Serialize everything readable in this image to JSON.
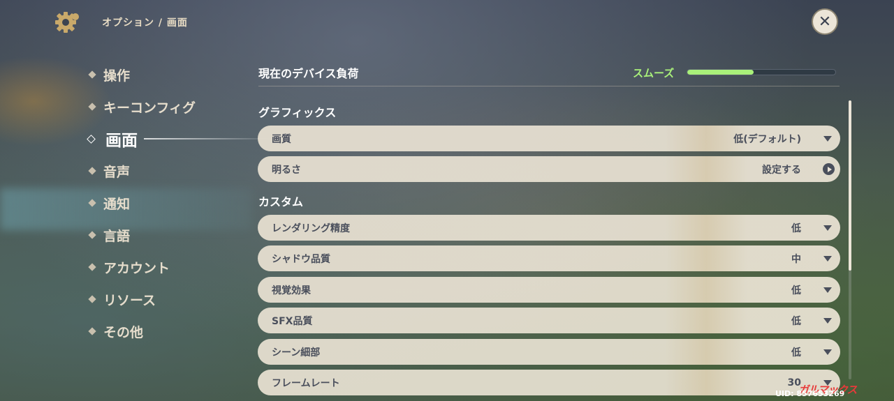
{
  "header": {
    "breadcrumb": "オプション / 画面"
  },
  "sidebar": {
    "items": [
      {
        "label": "操作"
      },
      {
        "label": "キーコンフィグ"
      },
      {
        "label": "画面",
        "active": true
      },
      {
        "label": "音声"
      },
      {
        "label": "通知"
      },
      {
        "label": "言語"
      },
      {
        "label": "アカウント"
      },
      {
        "label": "リソース"
      },
      {
        "label": "その他"
      }
    ]
  },
  "device_load": {
    "title": "現在のデバイス負荷",
    "status": "スムーズ",
    "level_percent": 45,
    "color": "#a9f07a"
  },
  "graphics": {
    "title": "グラフィックス",
    "quality": {
      "label": "画質",
      "value": "低(デフォルト)"
    },
    "brightness": {
      "label": "明るさ",
      "value": "設定する"
    }
  },
  "custom": {
    "title": "カスタム",
    "rows": [
      {
        "label": "レンダリング精度",
        "value": "低"
      },
      {
        "label": "シャドウ品質",
        "value": "中"
      },
      {
        "label": "視覚効果",
        "value": "低"
      },
      {
        "label": "SFX品質",
        "value": "低"
      },
      {
        "label": "シーン細部",
        "value": "低"
      },
      {
        "label": "フレームレート",
        "value": "30"
      }
    ]
  },
  "footer": {
    "uid": "UID: 857653269",
    "watermark": "ガルマックス"
  }
}
